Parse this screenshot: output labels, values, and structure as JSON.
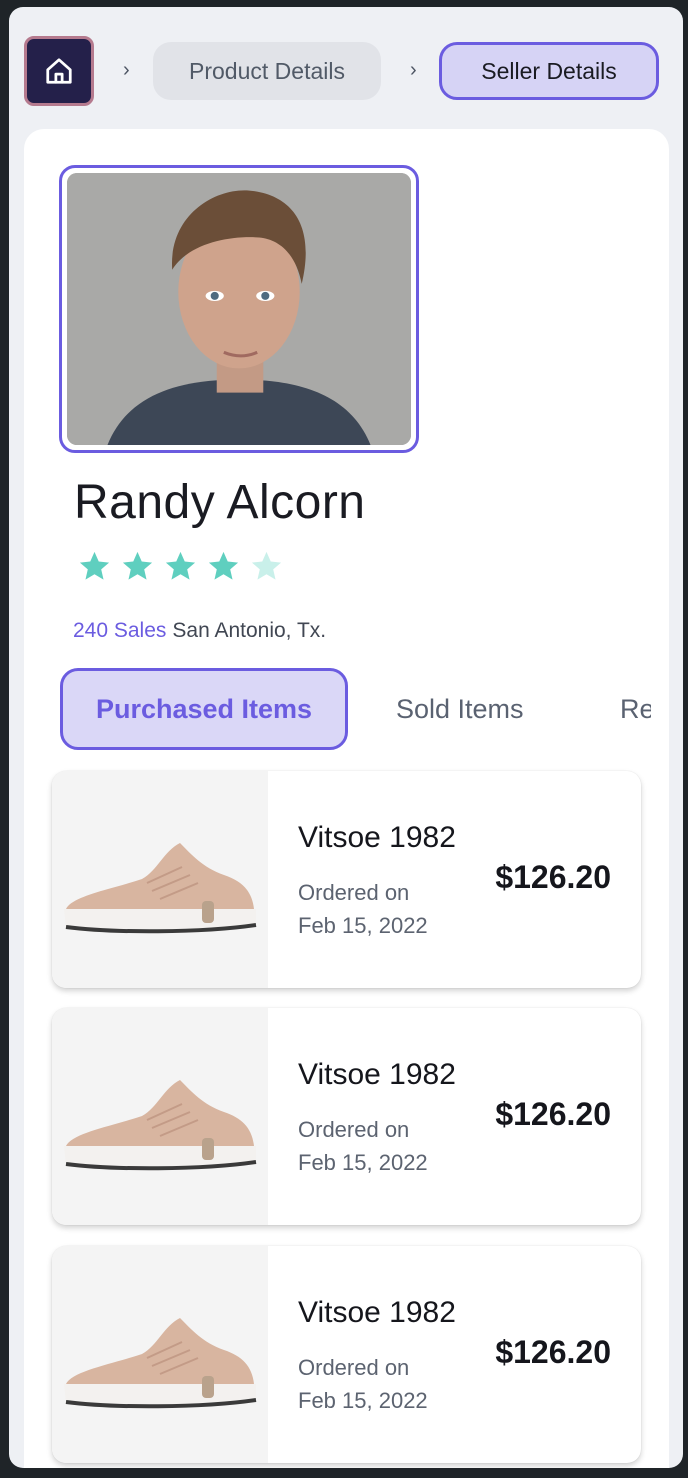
{
  "breadcrumb": {
    "items": [
      {
        "label": "Product Details"
      },
      {
        "label": "Seller Details"
      }
    ]
  },
  "seller": {
    "name": "Randy Alcorn",
    "rating": 4,
    "rating_max": 5,
    "sales": "240 Sales",
    "location": "San Antonio, Tx."
  },
  "tabs": [
    {
      "label": "Purchased Items",
      "active": true
    },
    {
      "label": "Sold Items",
      "active": false
    },
    {
      "label": "Re",
      "active": false
    }
  ],
  "items": [
    {
      "name": "Vitsoe 1982",
      "meta_line1": "Ordered on",
      "meta_line2": "Feb 15, 2022",
      "price": "$126.20"
    },
    {
      "name": "Vitsoe 1982",
      "meta_line1": "Ordered on",
      "meta_line2": "Feb 15, 2022",
      "price": "$126.20"
    },
    {
      "name": "Vitsoe 1982",
      "meta_line1": "Ordered on",
      "meta_line2": "Feb 15, 2022",
      "price": "$126.20"
    }
  ],
  "colors": {
    "accent": "#6b5ce0",
    "accent_light": "#dad7f7",
    "star": "#5fcfbf",
    "star_empty": "#c9f0ea",
    "home_bg": "#24204a"
  },
  "icons": {
    "home": "home-icon",
    "chevron": "chevron-right-icon",
    "star": "star-icon"
  }
}
